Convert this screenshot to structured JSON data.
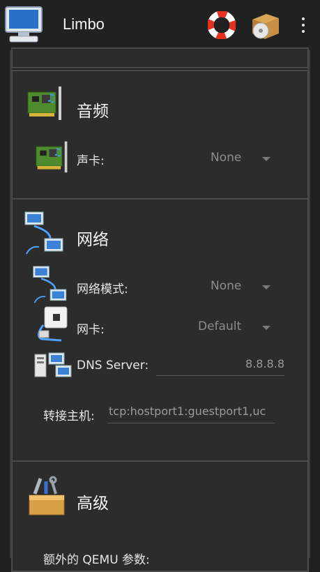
{
  "appbar": {
    "title": "Limbo",
    "icons": [
      "computer-icon",
      "help-lifebuoy-icon",
      "package-disc-icon",
      "overflow-menu-icon"
    ]
  },
  "audio": {
    "title": "音频",
    "sound_card_label": "声卡:",
    "sound_card_value": "None"
  },
  "network": {
    "title": "网络",
    "mode_label": "网络模式:",
    "mode_value": "None",
    "nic_label": "网卡:",
    "nic_value": "Default",
    "dns_label": "DNS Server:",
    "dns_value": "8.8.8.8",
    "hostfwd_label": "转接主机:",
    "hostfwd_value": "tcp:hostport1:guestport1,uc"
  },
  "advanced": {
    "title": "高级",
    "extra_qemu_label": "额外的 QEMU 参数:"
  },
  "colors": {
    "background": "#1f1f1f",
    "card": "#2c2c2c",
    "border": "#4a4a4a",
    "text": "#e8e8e8",
    "muted": "#8c8c8c"
  }
}
